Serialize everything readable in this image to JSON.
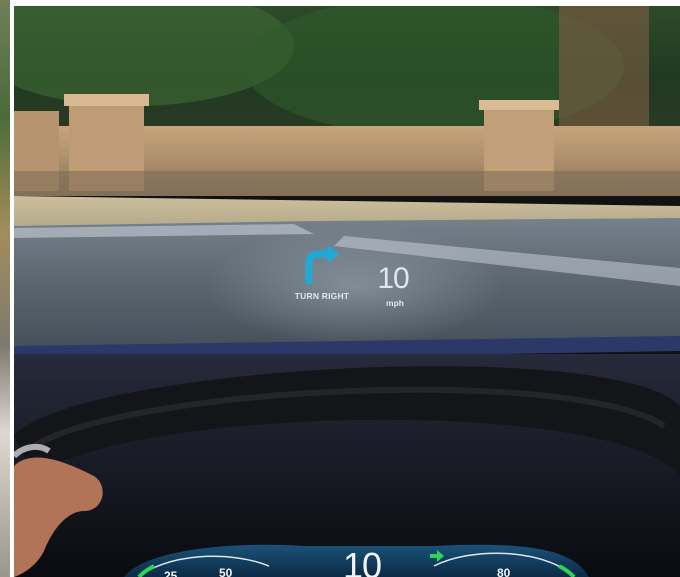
{
  "hud": {
    "instruction": "TURN RIGHT",
    "speed": "10",
    "unit": "mph",
    "arrow_color": "#1fa9d8"
  },
  "cluster": {
    "speed": "10",
    "gauge_left_ticks": [
      "25",
      "50"
    ],
    "gauge_right_ticks": [
      "80"
    ],
    "indicator_color": "#2fd35a"
  },
  "icons": {
    "turn": "turn-right-arrow-icon",
    "indicator": "right-arrow-indicator-icon"
  }
}
